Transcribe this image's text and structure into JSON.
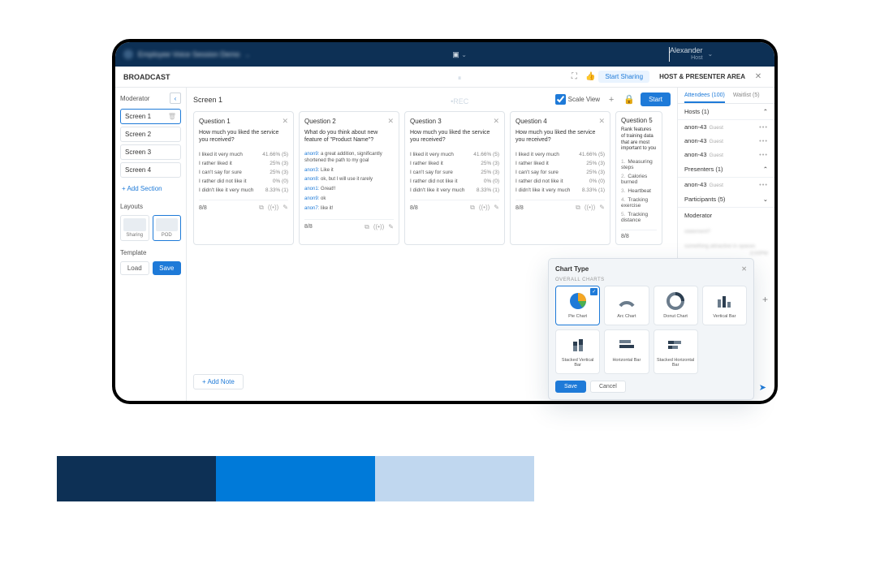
{
  "topbar": {
    "title": "Employee Voice Session Demo",
    "rec": "•REC",
    "user_name": "Alexander",
    "user_role": "Host"
  },
  "subbar": {
    "crumb": "BROADCAST",
    "start_sharing": "Start Sharing",
    "host_area": "HOST & PRESENTER AREA"
  },
  "left": {
    "moderator": "Moderator",
    "screens": [
      "Screen 1",
      "Screen 2",
      "Screen 3",
      "Screen 4"
    ],
    "add_section": "+  Add Section",
    "layouts_label": "Layouts",
    "layouts": [
      "Sharing",
      "POD"
    ],
    "template_label": "Template",
    "load": "Load",
    "save": "Save"
  },
  "center": {
    "title": "Screen 1",
    "scale": "Scale View",
    "start": "Start",
    "add_note": "+   Add Note",
    "q_service": {
      "text": "How much you liked the service you received?",
      "opts": [
        {
          "l": "I liked it very much",
          "v": "41.66% (5)"
        },
        {
          "l": "I rather liked it",
          "v": "25% (3)"
        },
        {
          "l": "I can't say for sure",
          "v": "25% (3)"
        },
        {
          "l": "I rather did not like it",
          "v": "0% (0)"
        },
        {
          "l": "I didn't like it very much",
          "v": "8.33% (1)"
        }
      ],
      "count": "8/8"
    },
    "q2": {
      "title": "Question 2",
      "text": "What do you think about new feature of \"Product Name\"?",
      "comments": [
        {
          "a": "anon9:",
          "t": "a great addition, significantly shortened the path to my goal"
        },
        {
          "a": "anon3:",
          "t": "Like it"
        },
        {
          "a": "anon8:",
          "t": "ok, but I will use it rarely"
        },
        {
          "a": "anon1:",
          "t": "Great!!"
        },
        {
          "a": "anon9:",
          "t": "ok"
        },
        {
          "a": "anon7:",
          "t": "like it!"
        }
      ],
      "count": "8/8"
    },
    "q5": {
      "title": "Question 5",
      "text": "Rank features of training data that are most important to you",
      "ranks": [
        "Measuring steps",
        "Calories burned",
        "Heartbeat",
        "Tracking exercise",
        "Tracking distance"
      ],
      "count": "8/8"
    },
    "titles": {
      "q1": "Question 1",
      "q3": "Question 3",
      "q4": "Question 4"
    }
  },
  "right": {
    "tabs": [
      "Attendees (100)",
      "Waitlist (5)"
    ],
    "hosts": "Hosts (1)",
    "presenters": "Presenters (1)",
    "participants": "Participants (5)",
    "moderator": "Moderator",
    "person": {
      "name": "anon-43",
      "role": "Guest"
    },
    "blur": [
      "statement?",
      "something attractive in spaces",
      "3:00PM",
      "statement?"
    ]
  },
  "modal": {
    "title": "Chart Type",
    "sub": "OVERALL CHARTS",
    "types": [
      "Pie Chart",
      "Arc Chart",
      "Donut Chart",
      "Vertical Bar",
      "Stacked Vertical Bar",
      "Horizontal Bar",
      "Stacked Horizontal Bar"
    ],
    "save": "Save",
    "cancel": "Cancel"
  },
  "swatches": [
    "#0d3055",
    "#007ad9",
    "#c0d7ef"
  ]
}
